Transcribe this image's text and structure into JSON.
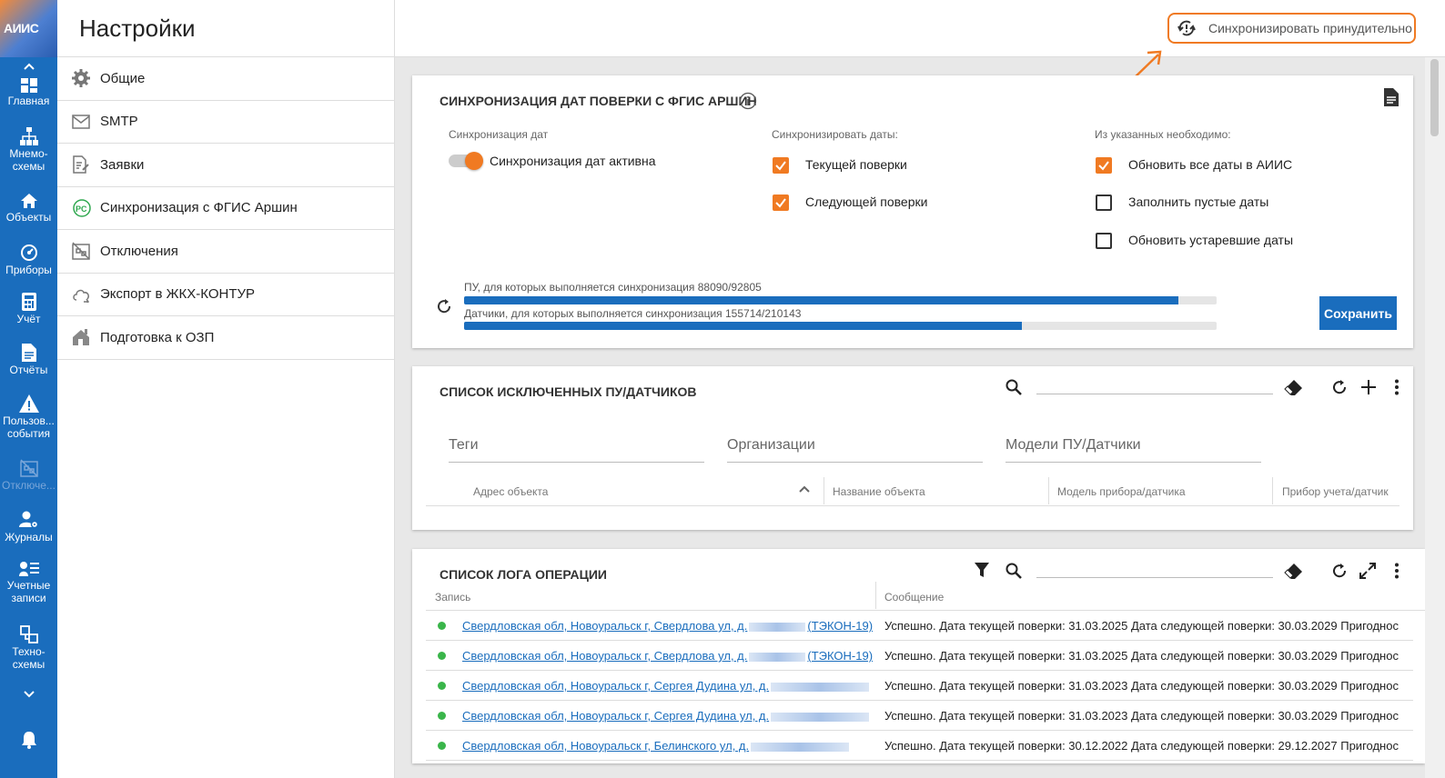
{
  "app": {
    "logo_text": "АИИС"
  },
  "rail": {
    "items": [
      {
        "label": "Главная",
        "icon": "dashboard-icon"
      },
      {
        "label": "Мнемо-\nсхемы",
        "icon": "hierarchy-icon"
      },
      {
        "label": "Объекты",
        "icon": "home-icon"
      },
      {
        "label": "Приборы",
        "icon": "gauge-icon"
      },
      {
        "label": "Учёт",
        "icon": "calculator-icon"
      },
      {
        "label": "Отчёты",
        "icon": "document-icon"
      },
      {
        "label": "Пользов...\nсобытия",
        "icon": "warning-icon"
      },
      {
        "label": "Отключе...",
        "icon": "outage-icon"
      },
      {
        "label": "Журналы",
        "icon": "user-gear-icon"
      },
      {
        "label": "Учетные\nзаписи",
        "icon": "accounts-icon"
      },
      {
        "label": "Техно-\nсхемы",
        "icon": "techscheme-icon"
      }
    ]
  },
  "header": {
    "title": "Настройки",
    "sync_button_label": "Синхронизировать принудительно"
  },
  "settings_nav": [
    {
      "label": "Общие",
      "icon": "gear-icon"
    },
    {
      "label": "SMTP",
      "icon": "mail-icon"
    },
    {
      "label": "Заявки",
      "icon": "request-icon"
    },
    {
      "label": "Синхронизация с ФГИС Аршин",
      "icon": "rs-logo-icon"
    },
    {
      "label": "Отключения",
      "icon": "outage-icon"
    },
    {
      "label": "Экспорт в ЖКХ-КОНТУР",
      "icon": "cloud-export-icon"
    },
    {
      "label": "Подготовка к ОЗП",
      "icon": "house-prep-icon"
    }
  ],
  "sync_card": {
    "title": "СИНХРОНИЗАЦИЯ ДАТ ПОВЕРКИ С ФГИС АРШИН",
    "col1_label": "Синхронизация дат",
    "toggle_label": "Синхронизация дат активна",
    "toggle_on": true,
    "col2_label": "Синхронизировать даты:",
    "col2_options": [
      {
        "label": "Текущей поверки",
        "checked": true
      },
      {
        "label": "Следующей поверки",
        "checked": true
      }
    ],
    "col3_label": "Из указанных необходимо:",
    "col3_options": [
      {
        "label": "Обновить все даты в АИИС",
        "checked": true
      },
      {
        "label": "Заполнить пустые даты",
        "checked": false
      },
      {
        "label": "Обновить устаревшие даты",
        "checked": false
      }
    ],
    "progress": [
      {
        "label": "ПУ, для которых выполняется синхронизация 88090/92805",
        "fraction": 0.949
      },
      {
        "label": "Датчики, для которых выполняется синхронизация 155714/210143",
        "fraction": 0.741
      }
    ],
    "save_label": "Сохранить"
  },
  "excluded_card": {
    "title": "СПИСОК ИСКЛЮЧЕННЫХ ПУ/ДАТЧИКОВ",
    "filters": [
      "Теги",
      "Организации",
      "Модели ПУ/Датчики"
    ],
    "columns": [
      "Адрес объекта",
      "Название объекта",
      "Модель прибора/датчика",
      "Прибор учета/датчик"
    ]
  },
  "log_card": {
    "title": "СПИСОК ЛОГА ОПЕРАЦИИ",
    "columns": [
      "Запись",
      "Сообщение"
    ],
    "rows": [
      {
        "record_start": "Свердловская обл, Новоуральск г, Свердлова ул, д.",
        "record_end": "(ТЭКОН-19)",
        "message": "Успешно. Дата текущей поверки: 31.03.2025 Дата следующей поверки: 30.03.2029 Пригоднос"
      },
      {
        "record_start": "Свердловская обл, Новоуральск г, Свердлова ул, д.",
        "record_end": "(ТЭКОН-19)",
        "message": "Успешно. Дата текущей поверки: 31.03.2025 Дата следующей поверки: 30.03.2029 Пригоднос"
      },
      {
        "record_start": "Свердловская обл, Новоуральск г, Сергея Дудина ул, д.",
        "record_end": "",
        "message": "Успешно. Дата текущей поверки: 31.03.2023 Дата следующей поверки: 30.03.2029 Пригоднос"
      },
      {
        "record_start": "Свердловская обл, Новоуральск г, Сергея Дудина ул, д.",
        "record_end": "",
        "message": "Успешно. Дата текущей поверки: 31.03.2023 Дата следующей поверки: 30.03.2029 Пригоднос"
      },
      {
        "record_start": "Свердловская обл, Новоуральск г, Белинского ул, д.",
        "record_end": "",
        "message": "Успешно. Дата текущей поверки: 30.12.2022 Дата следующей поверки: 29.12.2027 Пригоднос"
      }
    ]
  },
  "colors": {
    "brand_blue": "#1a6dbd",
    "accent_orange": "#f07a22",
    "status_green": "#3ab54a"
  }
}
